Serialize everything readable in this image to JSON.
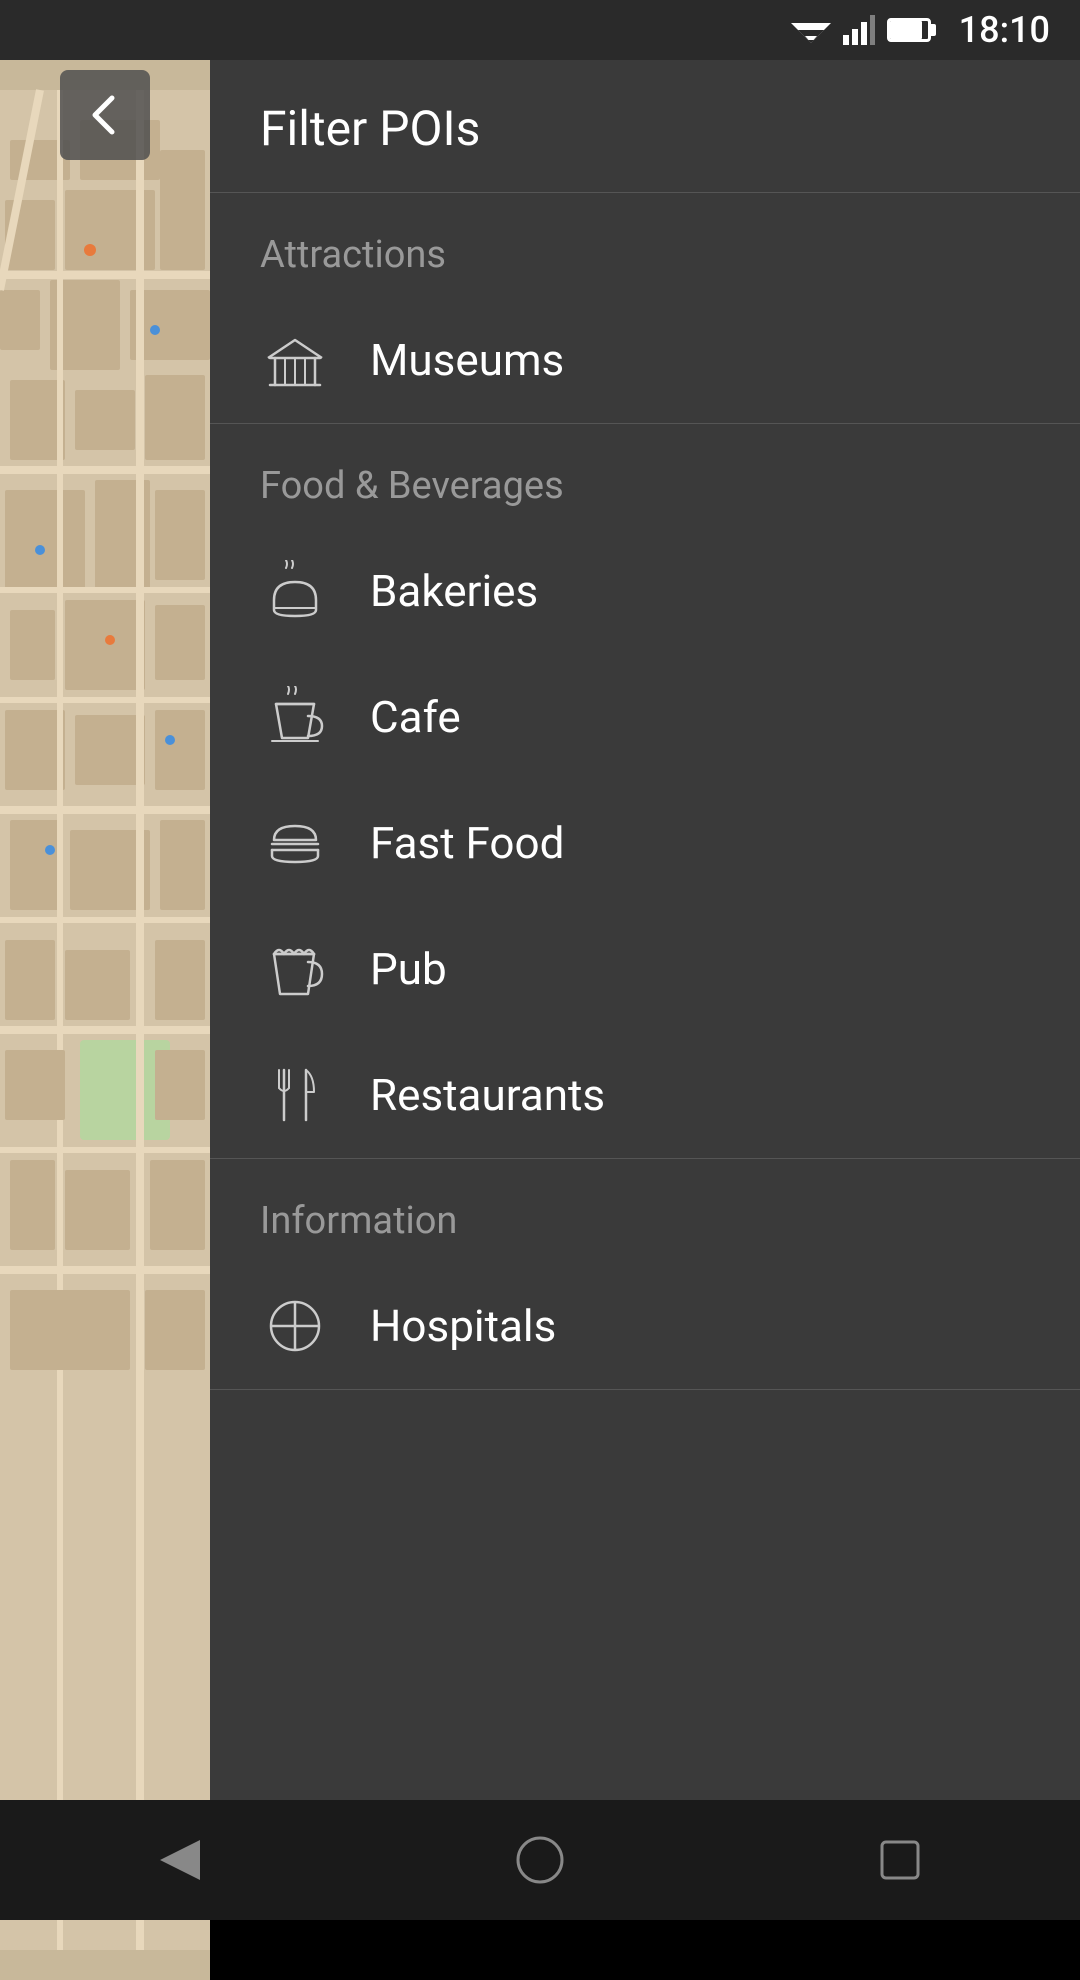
{
  "statusBar": {
    "time": "18:10"
  },
  "filterPanel": {
    "title": "Filter POIs",
    "sections": [
      {
        "id": "attractions",
        "label": "Attractions",
        "items": [
          {
            "id": "museums",
            "label": "Museums",
            "icon": "museum"
          }
        ]
      },
      {
        "id": "food-beverages",
        "label": "Food & Beverages",
        "items": [
          {
            "id": "bakeries",
            "label": "Bakeries",
            "icon": "bakery"
          },
          {
            "id": "cafe",
            "label": "Cafe",
            "icon": "cafe"
          },
          {
            "id": "fast-food",
            "label": "Fast Food",
            "icon": "fastfood"
          },
          {
            "id": "pub",
            "label": "Pub",
            "icon": "pub"
          },
          {
            "id": "restaurants",
            "label": "Restaurants",
            "icon": "restaurant"
          }
        ]
      },
      {
        "id": "information",
        "label": "Information",
        "items": [
          {
            "id": "hospitals",
            "label": "Hospitals",
            "icon": "hospital"
          }
        ]
      }
    ]
  },
  "navBar": {
    "back": "back",
    "home": "home",
    "recents": "recents"
  }
}
